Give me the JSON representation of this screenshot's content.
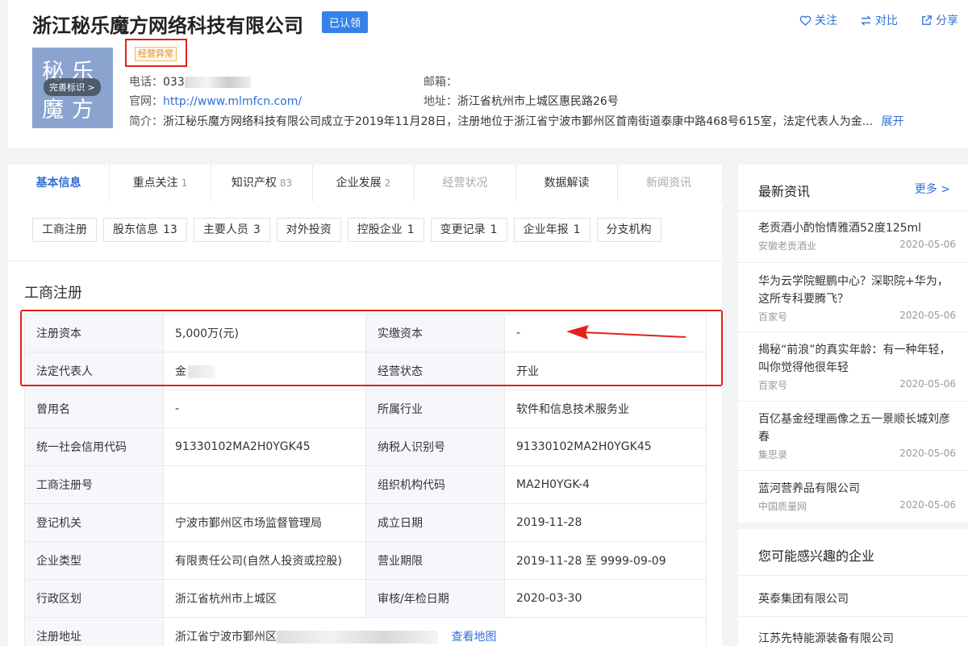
{
  "header": {
    "company_name": "浙江秘乐魔方网络科技有限公司",
    "claimed_badge": "已认领",
    "actions": {
      "follow": "关注",
      "compare": "对比",
      "share": "分享"
    },
    "status_badge": "经营异常",
    "logo": {
      "row1": "秘乐",
      "row2": "魔方",
      "tag": "完善标识 >"
    },
    "phone_label": "电话：",
    "phone_value": "033",
    "email_label": "邮箱：",
    "website_label": "官网：",
    "website_value": "http://www.mlmfcn.com/",
    "address_label": "地址：",
    "address_value": "浙江省杭州市上城区惠民路26号",
    "intro_label": "简介：",
    "intro_value": "浙江秘乐魔方网络科技有限公司成立于2019年11月28日，注册地位于浙江省宁波市鄞州区首南街道泰康中路468号615室，法定代表人为金...",
    "expand_label": "展开"
  },
  "tabs": [
    {
      "label": "基本信息",
      "count": ""
    },
    {
      "label": "重点关注",
      "count": "1"
    },
    {
      "label": "知识产权",
      "count": "83"
    },
    {
      "label": "企业发展",
      "count": "2"
    },
    {
      "label": "经营状况",
      "count": ""
    },
    {
      "label": "数据解读",
      "count": ""
    },
    {
      "label": "新闻资讯",
      "count": ""
    }
  ],
  "subtabs": [
    {
      "label": "工商注册",
      "count": ""
    },
    {
      "label": "股东信息",
      "count": "13"
    },
    {
      "label": "主要人员",
      "count": "3"
    },
    {
      "label": "对外投资",
      "count": ""
    },
    {
      "label": "控股企业",
      "count": "1"
    },
    {
      "label": "变更记录",
      "count": "1"
    },
    {
      "label": "企业年报",
      "count": "1"
    },
    {
      "label": "分支机构",
      "count": ""
    }
  ],
  "section_title": "工商注册",
  "registration": {
    "rows": [
      [
        "注册资本",
        "5,000万(元)",
        "实缴资本",
        "-"
      ],
      [
        "法定代表人",
        "金",
        "经营状态",
        "开业"
      ],
      [
        "曾用名",
        "-",
        "所属行业",
        "软件和信息技术服务业"
      ],
      [
        "统一社会信用代码",
        "91330102MA2H0YGK45",
        "纳税人识别号",
        "91330102MA2H0YGK45"
      ],
      [
        "工商注册号",
        "",
        "组织机构代码",
        "MA2H0YGK-4"
      ],
      [
        "登记机关",
        "宁波市鄞州区市场监督管理局",
        "成立日期",
        "2019-11-28"
      ],
      [
        "企业类型",
        "有限责任公司(自然人投资或控股)",
        "营业期限",
        "2019-11-28 至 9999-09-09"
      ],
      [
        "行政区划",
        "浙江省杭州市上城区",
        "审核/年检日期",
        "2020-03-30"
      ]
    ],
    "address_label": "注册地址",
    "address_value": "浙江省宁波市鄞州区",
    "map_link": "查看地图"
  },
  "news_panel": {
    "title": "最新资讯",
    "more": "更多 >",
    "items": [
      {
        "title": "老贡酒小酌怡情雅酒52度125ml",
        "source": "安徽老贡酒业",
        "date": "2020-05-06"
      },
      {
        "title": "华为云学院鲲鹏中心？深职院+华为，这所专科要腾飞？",
        "source": "百家号",
        "date": "2020-05-06"
      },
      {
        "title": "揭秘“前浪”的真实年龄：有一种年轻，叫你觉得他很年轻",
        "source": "百家号",
        "date": "2020-05-06"
      },
      {
        "title": "百亿基金经理画像之五一景顺长城刘彦春",
        "source": "集思录",
        "date": "2020-05-06"
      },
      {
        "title": "蓝河营养品有限公司",
        "source": "中国质量网",
        "date": "2020-05-06"
      }
    ]
  },
  "recommend_panel": {
    "title": "您可能感兴趣的企业",
    "items": [
      "英泰集团有限公司",
      "江苏先特能源装备有限公司"
    ]
  },
  "colors": {
    "accent": "#2f6fd6",
    "badge_blue": "#3582e8",
    "annotation_red": "#e3211b",
    "warning_orange": "#e78c22"
  }
}
